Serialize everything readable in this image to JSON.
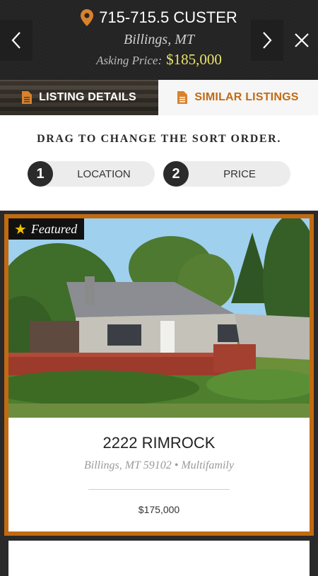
{
  "header": {
    "address": "715-715.5 CUSTER",
    "city": "Billings, MT",
    "asking_label": "Asking Price:",
    "asking_price": "$185,000"
  },
  "tabs": [
    {
      "label": "LISTING DETAILS",
      "active": false
    },
    {
      "label": "SIMILAR LISTINGS",
      "active": true
    }
  ],
  "sort": {
    "title": "DRAG TO CHANGE THE SORT ORDER.",
    "items": [
      {
        "number": "1",
        "label": "LOCATION"
      },
      {
        "number": "2",
        "label": "PRICE"
      }
    ]
  },
  "listing": {
    "badge": "Featured",
    "address": "2222 RIMROCK",
    "subtitle": "Billings, MT 59102 • Multifamily",
    "price": "$175,000"
  },
  "colors": {
    "accent": "#c16a12",
    "price_highlight": "#e9e36a",
    "header_bg": "#252525"
  },
  "icons": [
    "chevron-left-icon",
    "map-pin-icon",
    "chevron-right-icon",
    "close-icon",
    "document-icon",
    "star-icon"
  ]
}
